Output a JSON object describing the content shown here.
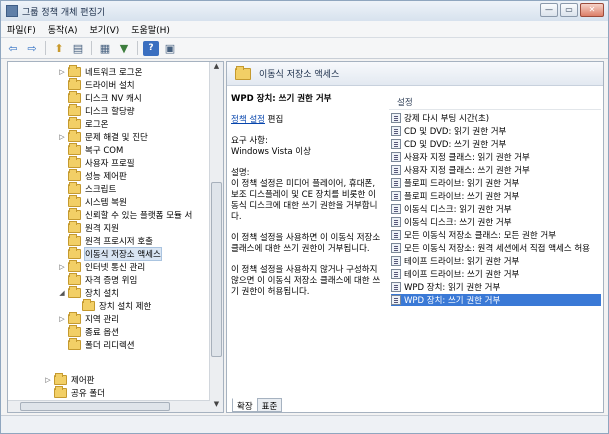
{
  "window": {
    "title": "그룹 정책 개체 편집기",
    "minimize": "—",
    "maximize": "▭",
    "close": "✕"
  },
  "menubar": [
    "파일(F)",
    "동작(A)",
    "보기(V)",
    "도움말(H)"
  ],
  "toolbar": [
    {
      "icon": "back-arrow-icon",
      "glyph": "⇦"
    },
    {
      "icon": "forward-arrow-icon",
      "glyph": "⇨"
    },
    {
      "icon": "up-folder-icon",
      "glyph": "⬆"
    },
    {
      "icon": "show-hide-tree-icon",
      "glyph": "▤"
    },
    {
      "icon": "export-list-icon",
      "glyph": "▦"
    },
    {
      "icon": "filter-icon",
      "glyph": "▼"
    },
    {
      "icon": "help-icon",
      "glyph": "?"
    },
    {
      "icon": "properties-icon",
      "glyph": "▣"
    }
  ],
  "tree": [
    {
      "label": "네트워크 로그온",
      "expander": "▷"
    },
    {
      "label": "드라이버 설치",
      "expander": ""
    },
    {
      "label": "디스크 NV 캐시",
      "expander": ""
    },
    {
      "label": "디스크 할당량",
      "expander": ""
    },
    {
      "label": "로그온",
      "expander": ""
    },
    {
      "label": "문제 해결 및 진단",
      "expander": "▷"
    },
    {
      "label": "복구 COM",
      "expander": ""
    },
    {
      "label": "사용자 프로필",
      "expander": ""
    },
    {
      "label": "성능 제어판",
      "expander": ""
    },
    {
      "label": "스크립트",
      "expander": ""
    },
    {
      "label": "시스템 복원",
      "expander": ""
    },
    {
      "label": "신뢰할 수 있는 플랫폼 모듈 서",
      "expander": ""
    },
    {
      "label": "원격 지원",
      "expander": ""
    },
    {
      "label": "원격 프로시저 호출",
      "expander": ""
    },
    {
      "label": "이동식 저장소 액세스",
      "expander": "",
      "selected": true
    },
    {
      "label": "인터넷 통신 관리",
      "expander": "▷"
    },
    {
      "label": "자격 증명 위임",
      "expander": ""
    },
    {
      "label": "장치 설치",
      "expander": "◢"
    },
    {
      "label": "장치 설치 제한",
      "expander": "",
      "indent": 1
    },
    {
      "label": "지역 관리",
      "expander": "▷"
    },
    {
      "label": "종료 옵션",
      "expander": ""
    },
    {
      "label": "폴더 리디렉션",
      "expander": ""
    },
    {
      "label": "제어판",
      "expander": "▷",
      "indent": -1
    },
    {
      "label": "공유 폴더",
      "expander": "",
      "indent": -1
    }
  ],
  "content": {
    "header": "이동식 저장소 액세스",
    "description": {
      "title": "WPD 장치: 쓰기 권한 거부",
      "edit_link": "정책 설정",
      "edit_suffix": " 편집",
      "requirements_label": "요구 사항:",
      "requirements_value": "Windows Vista 이상",
      "explanation_label": "설명:",
      "explanation_1": "이 정책 설정은 미디어 플레이어, 휴대폰, 보조 디스플레이 및 CE 장치를 비롯한 이동식 디스크에 대한 쓰기 권한을 거부합니다.",
      "explanation_2": "이 정책 설정을 사용하면 이 이동식 저장소 클래스에 대한 쓰기 권한이 거부됩니다.",
      "explanation_3": "이 정책 설정을 사용하지 않거나 구성하지 않으면 이 이동식 저장소 클래스에 대한 쓰기 권한이 허용됩니다."
    },
    "list_header": "설정",
    "settings": [
      "강제 다시 부팅 시간(초)",
      "CD 및 DVD: 읽기 권한 거부",
      "CD 및 DVD: 쓰기 권한 거부",
      "사용자 지정 클래스: 읽기 권한 거부",
      "사용자 지정 클래스: 쓰기 권한 거부",
      "플로피 드라이브: 읽기 권한 거부",
      "플로피 드라이브: 쓰기 권한 거부",
      "이동식 디스크: 읽기 권한 거부",
      "이동식 디스크: 쓰기 권한 거부",
      "모든 이동식 저장소 클래스: 모든 권한 거부",
      "모든 이동식 저장소: 원격 세션에서 직접 액세스 허용",
      "테이프 드라이브: 읽기 권한 거부",
      "테이프 드라이브: 쓰기 권한 거부",
      "WPD 장치: 읽기 권한 거부",
      "WPD 장치: 쓰기 권한 거부"
    ],
    "selected_index": 14
  },
  "tabs": [
    "확장",
    "표준"
  ]
}
